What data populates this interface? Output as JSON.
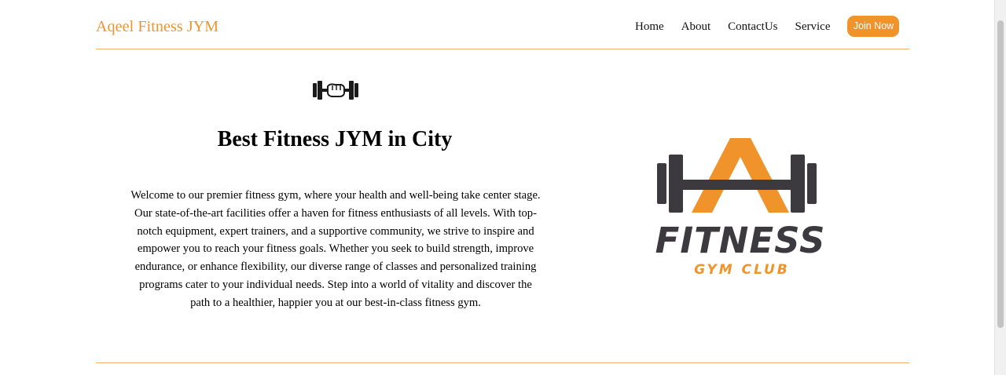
{
  "header": {
    "brand": "Aqeel Fitness JYM",
    "nav": [
      "Home",
      "About",
      "ContactUs",
      "Service"
    ],
    "cta": "Join Now"
  },
  "hero": {
    "title": "Best Fitness JYM in City",
    "description": "Welcome to our premier fitness gym, where your health and well-being take center stage. Our state-of-the-art facilities offer a haven for fitness enthusiasts of all levels. With top-notch equipment, expert trainers, and a supportive community, we strive to inspire and empower you to reach your fitness goals. Whether you seek to build strength, improve endurance, or enhance flexibility, our diverse range of classes and personalized training programs cater to your individual needs. Step into a world of vitality and discover the path to a healthier, happier you at our best-in-class fitness gym."
  },
  "logo": {
    "word": "FITNESS",
    "subtitle": "GYM CLUB",
    "colors": {
      "dark": "#3d3a3f",
      "accent": "#f0932b"
    }
  },
  "colors": {
    "accent": "#f0932b",
    "rule": "#f2b070"
  }
}
